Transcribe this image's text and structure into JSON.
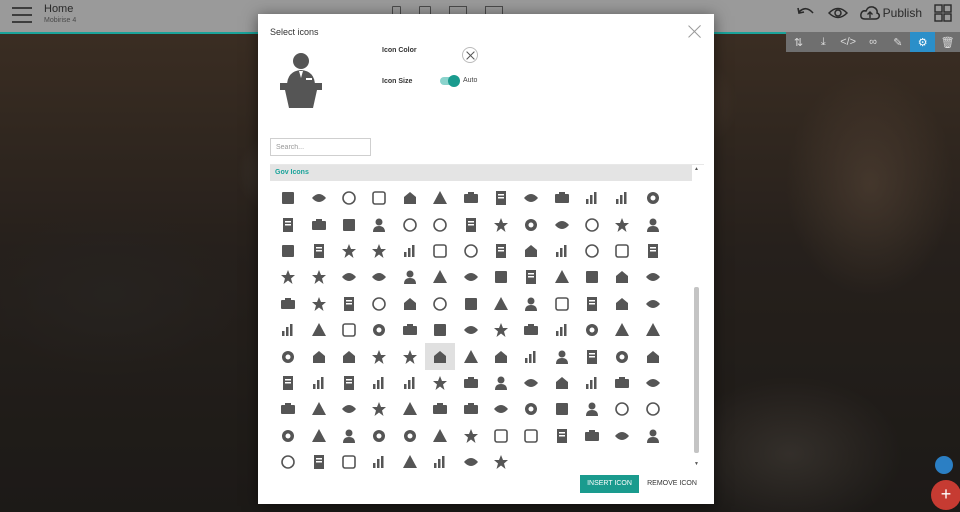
{
  "app": {
    "title": "Home",
    "subtitle": "Mobirise 4",
    "publish_label": "Publish"
  },
  "modal": {
    "title": "Select icons",
    "icon_color_label": "Icon Color",
    "icon_size_label": "Icon Size",
    "icon_size_value": "Auto",
    "search_placeholder": "Search...",
    "search_value": "",
    "group_name": "Gov Icons",
    "insert_label": "INSERT ICON",
    "remove_label": "REMOVE ICON",
    "selected_index": 83,
    "accent_color": "#1a9b8e",
    "icon_color": "#555555",
    "preview_icon": "speaker-podium-icon"
  },
  "icon_names": [
    "id-card-icon",
    "document-icon",
    "gear-icon",
    "airplane-icon",
    "ambulance-icon",
    "ammunition-icon",
    "scales-icon",
    "bar-chart-icon",
    "barcode-icon",
    "biohazard-icon",
    "book-icon",
    "briefcase-icon",
    "building-icon",
    "bus-icon",
    "calculator-icon",
    "badge-card-icon",
    "capitol-icon",
    "warning-icon",
    "award-ribbon-icon",
    "checkmark-icon",
    "checkbox-icon",
    "clock-icon",
    "cloud-icon",
    "cloud-outline-icon",
    "code-icon",
    "gear-icon",
    "gears-icon",
    "speech-bubble-icon",
    "conversation-icon",
    "court-icon",
    "database-icon",
    "desk-icon",
    "directions-icon",
    "monitor-icon",
    "dna-icon",
    "documents-icon",
    "donkey-icon",
    "no-weapons-icon",
    "elephant-icon",
    "factory-icon",
    "gear-outline-icon",
    "file-icon",
    "file-edit-icon",
    "excel-file-icon",
    "excel-outline-icon",
    "file-outline-icon",
    "text-file-icon",
    "text-file-outline-icon",
    "word-file-icon",
    "word-outline-icon",
    "fingerprint-icon",
    "folder-icon",
    "hospital-icon",
    "gavel-icon",
    "gear-icon",
    "gears-icon",
    "globe-icon",
    "gun-icon",
    "handshake-icon",
    "dome-icon",
    "heart-pulse-icon",
    "star-burst-icon",
    "id-badge-icon",
    "id-badge-outline-icon",
    "institution-icon",
    "jet-icon",
    "key-icon",
    "leaf-icon",
    "liberty-bell-icon",
    "lightbulb-icon",
    "gold-bars-icon",
    "line-chart-icon",
    "lock-icon",
    "medal-icon",
    "podium-award-icon",
    "medical-kit-icon",
    "metro-icon",
    "microscope-icon",
    "military-rifle-icon",
    "mobile-phone-icon",
    "money-icon",
    "nuclear-plant-icon",
    "pallet-icon",
    "pentagon-icon",
    "pie-chart-icon",
    "poison-icon",
    "medicine-jar-icon",
    "speaker-podium-icon",
    "target-icon",
    "radiation-icon",
    "recycle-icon",
    "crosshair-icon",
    "sights-icon",
    "rosette-icon",
    "road-icon",
    "roadblock-icon",
    "sack-icon",
    "ruler-icon",
    "satellite-icon",
    "scroll-icon",
    "magnifier-icon",
    "security-camera-icon",
    "shield-icon",
    "shield-outline-icon",
    "ship-icon",
    "statue-icon",
    "statue-of-liberty-icon",
    "stethoscope-icon",
    "submarine-icon",
    "table-icon",
    "table-edit-icon",
    "tablet-icon",
    "tank-icon",
    "tax-form-icon",
    "close-icon",
    "tools-icon",
    "oil-barrel-icon",
    "truck-icon",
    "truck-front-icon",
    "unlock-icon",
    "usa-flag-icon",
    "usa-flag-wave-icon",
    "usa-map-icon",
    "pillars-icon",
    "uncle-sam-hat-icon",
    "dollar-icon",
    "user-icon",
    "police-user-icon",
    "officer-icon",
    "graduate-icon",
    "user-tie-icon",
    "users-icon",
    "vault-icon",
    "warning-icon",
    "washington-monument-icon",
    "rally-icon",
    "white-house-icon",
    "world-icon"
  ]
}
